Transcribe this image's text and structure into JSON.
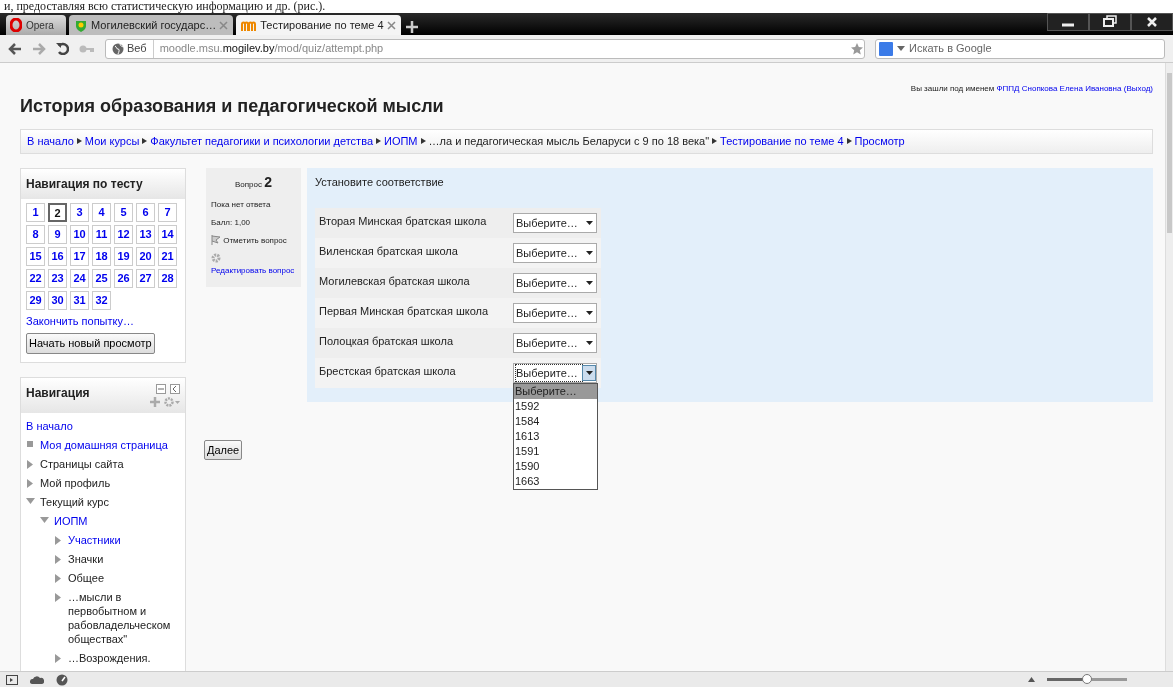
{
  "document_text": "и, предоставляя всю статистическую информацию и др. (рис.).",
  "browser": {
    "menu_button": "Opera",
    "tabs": [
      {
        "label": "Могилевский государс…",
        "selected": false,
        "kind": "site"
      },
      {
        "label": "Тестирование по теме 4",
        "selected": true,
        "kind": "moodle"
      }
    ],
    "address": {
      "badge": "Веб",
      "url": "moodle.msu.**mogilev.by**/mod/quiz/attempt.php"
    },
    "search": {
      "placeholder": "Искать в Google"
    }
  },
  "page": {
    "title": "История образования и педагогической мысли",
    "login": {
      "text": "Вы зашли под именем",
      "user": "ФППД Снопкова Елена Ивановна",
      "logout": "(Выход)"
    },
    "breadcrumb": [
      {
        "label": "В начало",
        "link": true
      },
      {
        "label": "Мои курсы",
        "link": true
      },
      {
        "label": "Факультет педагогики и психологии детства",
        "link": true
      },
      {
        "label": "ИОПМ",
        "link": true
      },
      {
        "label": "…ла и педагогическая мысль Беларуси с 9 по 18 века\"",
        "link": false
      },
      {
        "label": "Тестирование по теме 4",
        "link": true
      },
      {
        "label": "Просмотр",
        "link": true
      }
    ],
    "quiz_nav": {
      "title": "Навигация по тесту",
      "questions": [
        {
          "label": "1",
          "selected": false
        },
        {
          "label": "2",
          "selected": true
        },
        {
          "label": "3",
          "selected": false
        },
        {
          "label": "4",
          "selected": false
        },
        {
          "label": "5",
          "selected": false
        },
        {
          "label": "6",
          "selected": false
        },
        {
          "label": "7",
          "selected": false
        },
        {
          "label": "8",
          "selected": false
        },
        {
          "label": "9",
          "selected": false
        },
        {
          "label": "10",
          "selected": false
        },
        {
          "label": "11",
          "selected": false
        },
        {
          "label": "12",
          "selected": false
        },
        {
          "label": "13",
          "selected": false
        },
        {
          "label": "14",
          "selected": false
        },
        {
          "label": "15",
          "selected": false
        },
        {
          "label": "16",
          "selected": false
        },
        {
          "label": "17",
          "selected": false
        },
        {
          "label": "18",
          "selected": false
        },
        {
          "label": "19",
          "selected": false
        },
        {
          "label": "20",
          "selected": false
        },
        {
          "label": "21",
          "selected": false
        },
        {
          "label": "22",
          "selected": false
        },
        {
          "label": "23",
          "selected": false
        },
        {
          "label": "24",
          "selected": false
        },
        {
          "label": "25",
          "selected": false
        },
        {
          "label": "26",
          "selected": false
        },
        {
          "label": "27",
          "selected": false
        },
        {
          "label": "28",
          "selected": false
        },
        {
          "label": "29",
          "selected": false
        },
        {
          "label": "30",
          "selected": false
        },
        {
          "label": "31",
          "selected": false
        },
        {
          "label": "32",
          "selected": false
        }
      ],
      "finish_link": "Закончить попытку…",
      "new_preview_button": "Начать новый просмотр"
    },
    "navigation": {
      "title": "Навигация",
      "items": [
        {
          "label": "В начало",
          "kind": "plain",
          "link": true
        },
        {
          "label": "Моя домашняя страница",
          "kind": "bullet",
          "link": true
        },
        {
          "label": "Страницы сайта",
          "kind": "branch",
          "link": false,
          "expanded": false
        },
        {
          "label": "Мой профиль",
          "kind": "branch",
          "link": false,
          "expanded": false
        },
        {
          "label": "Текущий курс",
          "kind": "branch",
          "link": false,
          "expanded": true,
          "children": [
            {
              "label": "ИОПМ",
              "kind": "branch",
              "link": true,
              "expanded": true,
              "children": [
                {
                  "label": "Участники",
                  "kind": "branch",
                  "link": true,
                  "expanded": false
                },
                {
                  "label": "Значки",
                  "kind": "branch",
                  "link": false,
                  "expanded": false
                },
                {
                  "label": "Общее",
                  "kind": "branch",
                  "link": false,
                  "expanded": false
                },
                {
                  "label": "…мысли в первобытном и рабовладельческом обществах\"",
                  "kind": "branch",
                  "link": false,
                  "expanded": false
                },
                {
                  "label": "…Возрождения.",
                  "kind": "branch",
                  "link": false,
                  "expanded": false
                }
              ]
            }
          ]
        }
      ]
    },
    "question": {
      "label": "Вопрос",
      "number": "2",
      "state": "Пока нет ответа",
      "mark": "Балл: 1,00",
      "flag_link": "Отметить вопрос",
      "edit_link": "Редактировать вопрос",
      "prompt": "Установите соответствие",
      "rows": [
        {
          "label": "Вторая Минская братская школа",
          "choice": "Выберите…",
          "open": false
        },
        {
          "label": "Виленская братская школа",
          "choice": "Выберите…",
          "open": false
        },
        {
          "label": "Могилевская братская школа",
          "choice": "Выберите…",
          "open": false
        },
        {
          "label": "Первая Минская братская школа",
          "choice": "Выберите…",
          "open": false
        },
        {
          "label": "Полоцкая братская школа",
          "choice": "Выберите…",
          "open": false
        },
        {
          "label": "Брестская братская школа",
          "choice": "Выберите…",
          "open": true
        }
      ],
      "options": [
        {
          "label": "Выберите…",
          "selected": true
        },
        {
          "label": "1592",
          "selected": false
        },
        {
          "label": "1584",
          "selected": false
        },
        {
          "label": "1613",
          "selected": false
        },
        {
          "label": "1591",
          "selected": false
        },
        {
          "label": "1590",
          "selected": false
        },
        {
          "label": "1663",
          "selected": false
        }
      ]
    },
    "next_button": "Далее"
  },
  "status_bar": {
    "zoom": {
      "level": 0.5
    }
  }
}
